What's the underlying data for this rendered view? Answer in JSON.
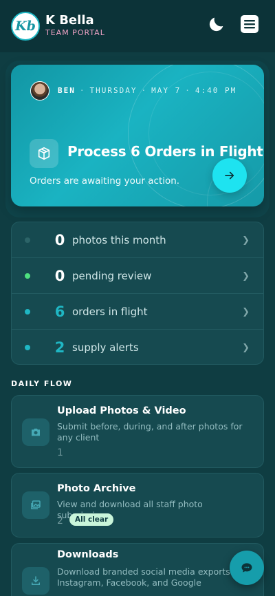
{
  "header": {
    "brand_name": "K Bella",
    "brand_sub": "TEAM PORTAL",
    "logo_text": "Kb"
  },
  "hero": {
    "user": "BEN",
    "day": "THURSDAY",
    "date": "MAY 7",
    "time": "4:40 PM",
    "title": "Process 6 Orders in Flight",
    "subtitle": "Orders are awaiting your action."
  },
  "stats": [
    {
      "value": "0",
      "label": "photos this month",
      "dot_color": "#2c6468",
      "num_color": "#ffffff"
    },
    {
      "value": "0",
      "label": "pending review",
      "dot_color": "#4ee07f",
      "num_color": "#ffffff"
    },
    {
      "value": "6",
      "label": "orders in flight",
      "dot_color": "#1fb7c4",
      "num_color": "#1fb7c4"
    },
    {
      "value": "2",
      "label": "supply alerts",
      "dot_color": "#1fb7c4",
      "num_color": "#1fb7c4"
    }
  ],
  "daily_flow": {
    "title": "DAILY FLOW",
    "cards": [
      {
        "title": "Upload Photos & Video",
        "desc": "Submit before, during, and after photos for any client",
        "count": "1",
        "icon": "camera-icon"
      },
      {
        "title": "Photo Archive",
        "desc": "View and download all staff photo submissions",
        "count": "2",
        "badge": "All clear",
        "icon": "image-icon"
      },
      {
        "title": "Downloads",
        "desc": "Download branded social media exports for Instagram, Facebook, and Google",
        "icon": "download-icon"
      }
    ]
  },
  "colors": {
    "accent": "#1fb7c4",
    "background": "#0f3d42",
    "badge_bg": "#c9f5da",
    "brand_sub": "#f0a3c6"
  }
}
